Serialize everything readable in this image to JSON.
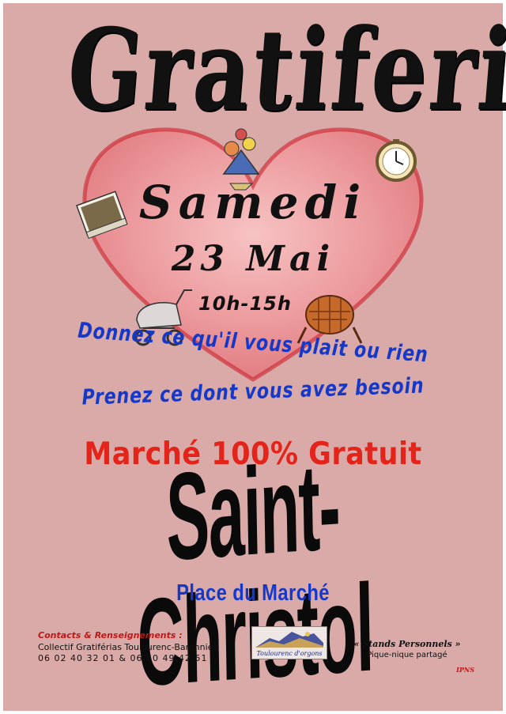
{
  "title": "Gratiferia",
  "day": "Samedi",
  "date": "23 Mai",
  "hours": "10h-15h",
  "slogan_line_1": "Donnez ce qu'il vous plait ou rien",
  "slogan_line_2": "Prenez ce dont vous avez besoin",
  "market_label": "Marché 100% Gratuit",
  "town": "Saint-Christol",
  "venue": "Place du Marché",
  "contacts": {
    "label": "Contacts & Renseignements :",
    "organisation": "Collectif Gratiférias Toulourenc-Baronnies",
    "phones": "06 02 40 32 01 & 06 60 49 42 51"
  },
  "logo": {
    "caption": "Toulourenc d'orgons"
  },
  "stands": {
    "label": "« Stands Personnels »",
    "subtext": "Pique-nique partagé"
  },
  "initials": "IPNS",
  "colors": {
    "background": "#d9aaa7",
    "heart": "#e58a8d",
    "heart_outline": "#cc2b36",
    "headline_blue": "#1638c8",
    "headline_red": "#e3241a",
    "text_black": "#111111"
  },
  "icons": [
    "flower-bouquet-icon",
    "clock-icon",
    "book-icon",
    "baby-pram-icon",
    "basket-icon"
  ]
}
